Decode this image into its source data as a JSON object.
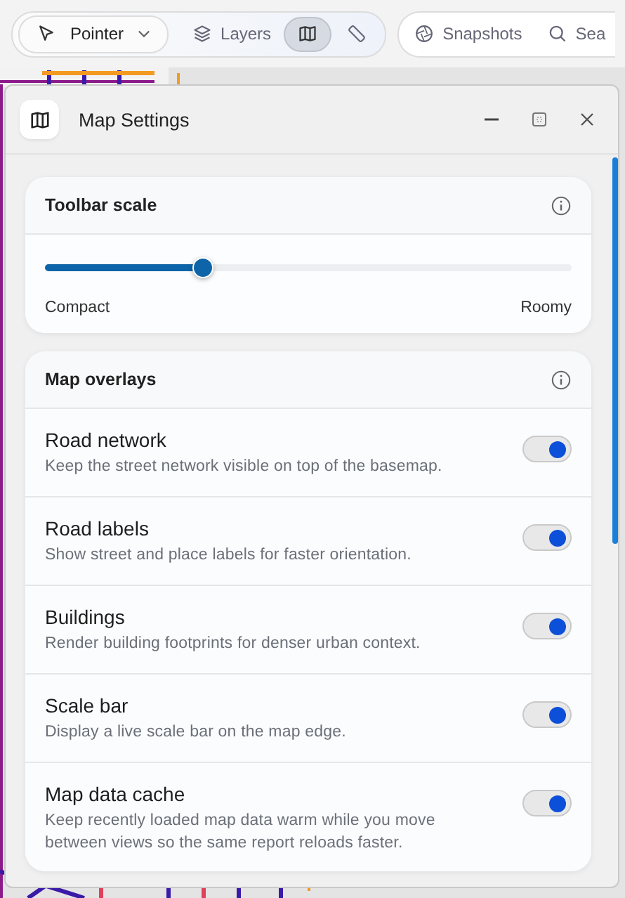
{
  "toolbar": {
    "tools": [
      {
        "kind": "dropdown",
        "label": "Pointer",
        "selected": false
      },
      {
        "kind": "text",
        "label": "Layers",
        "selected": false
      },
      {
        "kind": "icon",
        "selected": true
      },
      {
        "kind": "icon",
        "selected": false
      }
    ],
    "actions": [
      {
        "label": "Snapshots"
      },
      {
        "label": "Sea"
      }
    ]
  },
  "window": {
    "title": "Map Settings"
  },
  "scale_card": {
    "title": "Toolbar scale",
    "level": 0.3,
    "min_label": "Compact",
    "max_label": "Roomy"
  },
  "overlays_card": {
    "title": "Map overlays",
    "items": [
      {
        "name": "Road network",
        "description": "Keep the street network visible on top of the basemap.",
        "on": true
      },
      {
        "name": "Road labels",
        "description": "Show street and place labels for faster orientation.",
        "on": true
      },
      {
        "name": "Buildings",
        "description": "Render building footprints for denser urban context.",
        "on": true
      },
      {
        "name": "Scale bar",
        "description": "Display a live scale bar on the map edge.",
        "on": true
      },
      {
        "name": "Map data cache",
        "description": "Keep recently loaded map data warm while you move between views so the same report reloads faster.",
        "on": true
      }
    ]
  }
}
